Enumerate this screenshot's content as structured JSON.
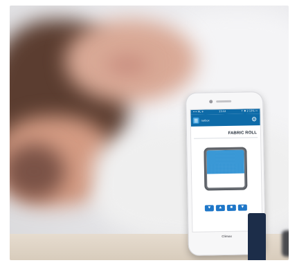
{
  "screen": {
    "status_left": "••• PL ✈",
    "status_time": "13:12",
    "status_right": "↑ ✱ 2 13% ▭",
    "app_title": "netbox",
    "device_title": "FABRIC ROLL",
    "controls": [
      "♥",
      "▲",
      "■",
      "▼"
    ]
  },
  "phone_brand": "Climax",
  "colors": {
    "accent": "#0e6ba8",
    "fabric": "#2a8fd2",
    "button": "#1f77c8",
    "stand": "#1c2d49"
  },
  "icons": [
    "menu-icon",
    "gear-icon",
    "heart-icon",
    "up-arrow-icon",
    "stop-icon",
    "down-arrow-icon"
  ]
}
